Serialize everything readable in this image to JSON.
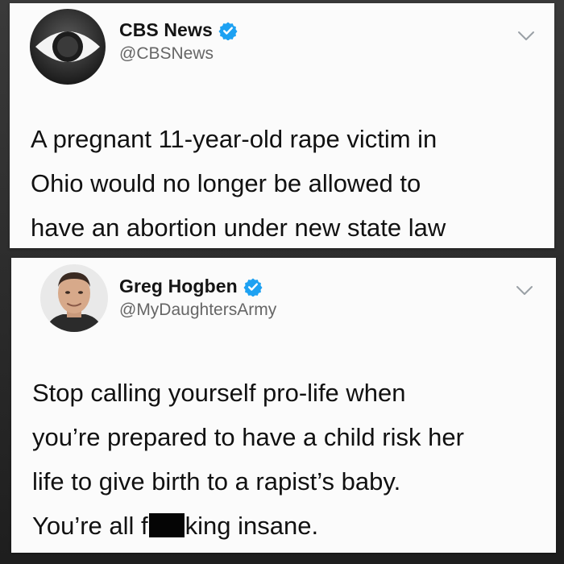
{
  "tweets": [
    {
      "author": {
        "display_name": "CBS News",
        "handle": "@CBSNews",
        "verified": true,
        "avatar_icon": "cbs-eye-logo"
      },
      "text_lines": [
        "A pregnant 11-year-old rape victim in",
        "Ohio would no longer be allowed to",
        "have an abortion under new state law"
      ]
    },
    {
      "author": {
        "display_name": "Greg Hogben",
        "handle": "@MyDaughtersArmy",
        "verified": true,
        "avatar_icon": "profile-photo"
      },
      "text_lines": [
        "Stop calling yourself pro-life when",
        "you’re prepared to have a child risk her",
        "life to give birth to a rapist’s baby."
      ],
      "last_line_before_censor": "You’re all f",
      "last_line_after_censor": "king insane."
    }
  ],
  "colors": {
    "verified_blue": "#1da1f2",
    "handle_gray": "#666666",
    "background": "#2a2a2a"
  }
}
